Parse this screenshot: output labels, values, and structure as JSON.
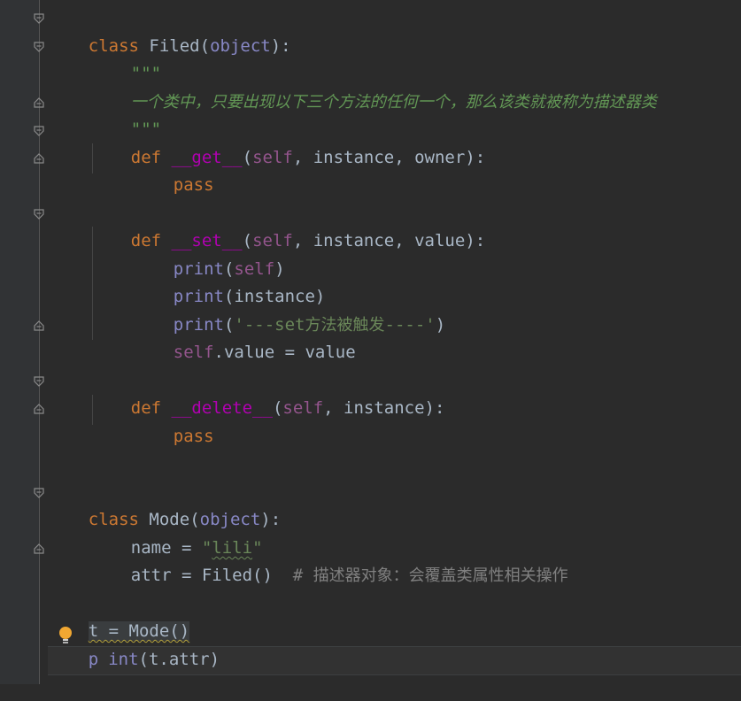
{
  "editor": {
    "lines": {
      "l1": {
        "kw": "class",
        "name": "Filed",
        "open": "(",
        "base": "object",
        "close": "):"
      },
      "l2": {
        "doc": "\"\"\""
      },
      "l3": {
        "doc": "一个类中，只要出现以下三个方法的任何一个，那么该类就被称为描述器类"
      },
      "l4": {
        "doc": "\"\"\""
      },
      "l5": {
        "kw": "def",
        "fn": "__get__",
        "open": "(",
        "self": "self",
        "p1": ", instance, owner",
        "close": "):"
      },
      "l6": {
        "kw": "pass"
      },
      "l8": {
        "kw": "def",
        "fn": "__set__",
        "open": "(",
        "self": "self",
        "p1": ", instance, value",
        "close": "):"
      },
      "l9": {
        "builtin": "print",
        "open": "(",
        "self": "self",
        "close": ")"
      },
      "l10": {
        "builtin": "print",
        "rest": "(instance)"
      },
      "l11": {
        "builtin": "print",
        "open": "(",
        "str_a": "'---set",
        "str_cn": "方法被触发",
        "str_b": "----'",
        "close": ")"
      },
      "l12": {
        "self": "self",
        "rest": ".value = value"
      },
      "l14": {
        "kw": "def",
        "fn": "__delete__",
        "open": "(",
        "self": "self",
        "p1": ", instance",
        "close": "):"
      },
      "l15": {
        "kw": "pass"
      },
      "l18": {
        "kw": "class",
        "name": "Mode",
        "open": "(",
        "base": "object",
        "close": "):"
      },
      "l19": {
        "lhs": "name = ",
        "q1": "\"",
        "str": "lili",
        "q2": "\""
      },
      "l20": {
        "code": "attr = Filed()  ",
        "hash": "# ",
        "comment": "描述器对象：会覆盖类属性相关操作"
      },
      "l22": {
        "code": "t = Mode()"
      },
      "l23": {
        "builtin_a": "p",
        "builtin_b": "int",
        "rest": "(t.attr)"
      }
    },
    "icons": {
      "fold": "fold-marker-icon",
      "bulb": "lightbulb-intention-icon"
    },
    "colors": {
      "background": "#2b2b2b",
      "keyword": "#cc7832",
      "magic_method": "#b200b2",
      "self": "#94558d",
      "builtin": "#8888c6",
      "string": "#6a8759",
      "comment": "#808080",
      "default": "#a9b7c6"
    }
  }
}
